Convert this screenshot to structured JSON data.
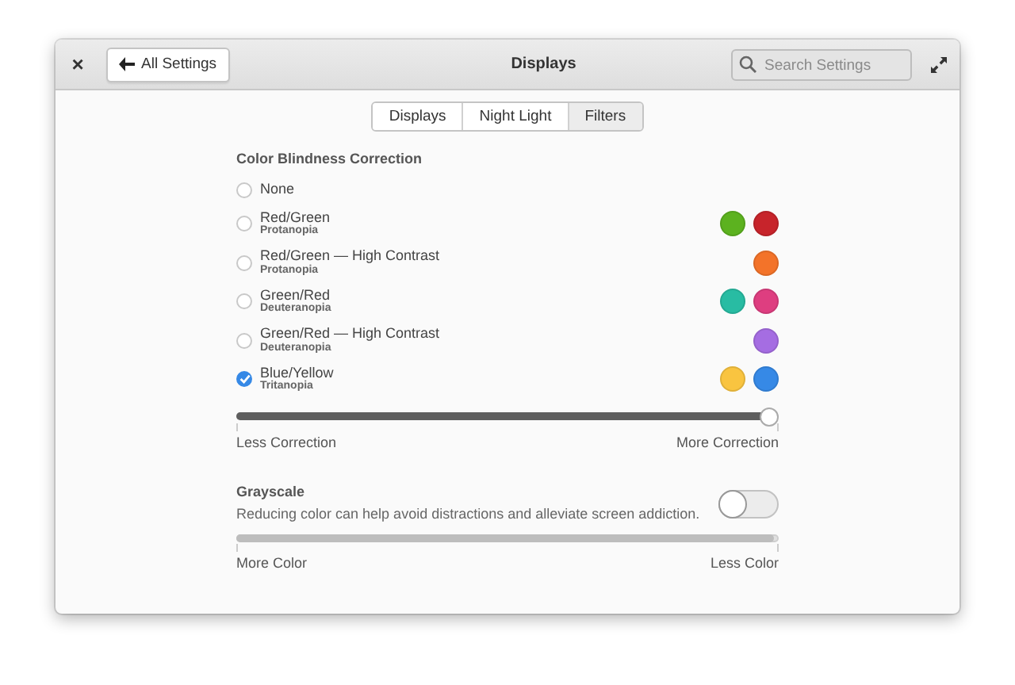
{
  "window": {
    "title": "Displays",
    "close_label": "×",
    "back_button": "All Settings",
    "search": {
      "placeholder": "Search Settings"
    }
  },
  "tabs": [
    {
      "label": "Displays",
      "selected": false
    },
    {
      "label": "Night Light",
      "selected": false
    },
    {
      "label": "Filters",
      "selected": true
    }
  ],
  "color_correction": {
    "heading": "Color Blindness Correction",
    "options": [
      {
        "label": "None",
        "selected": false
      },
      {
        "label": "Red/Green",
        "sublabel": "Protanopia",
        "selected": false,
        "swatches": [
          {
            "color": "#5cb21f"
          },
          {
            "color": "#c7242b"
          }
        ]
      },
      {
        "label": "Red/Green — High Contrast",
        "sublabel": "Protanopia",
        "selected": false,
        "swatches": [
          {
            "color": "#f37329"
          }
        ]
      },
      {
        "label": "Green/Red",
        "sublabel": "Deuteranopia",
        "selected": false,
        "swatches": [
          {
            "color": "#28bca3"
          },
          {
            "color": "#de3e80"
          }
        ]
      },
      {
        "label": "Green/Red — High Contrast",
        "sublabel": "Deuteranopia",
        "selected": false,
        "swatches": [
          {
            "color": "#a56de2"
          }
        ]
      },
      {
        "label": "Blue/Yellow",
        "sublabel": "Tritanopia",
        "selected": true,
        "swatches": [
          {
            "color": "#f9c440"
          },
          {
            "color": "#3689e6"
          }
        ]
      }
    ],
    "slider": {
      "level": 1,
      "disabled": false,
      "min_label": "Less Correction",
      "max_label": "More Correction"
    }
  },
  "grayscale": {
    "heading": "Grayscale",
    "description": "Reducing color can help avoid distractions and alleviate screen addiction.",
    "on": false,
    "slider": {
      "level": 0.99,
      "disabled": true,
      "min_label": "More Color",
      "max_label": "Less Color"
    }
  }
}
